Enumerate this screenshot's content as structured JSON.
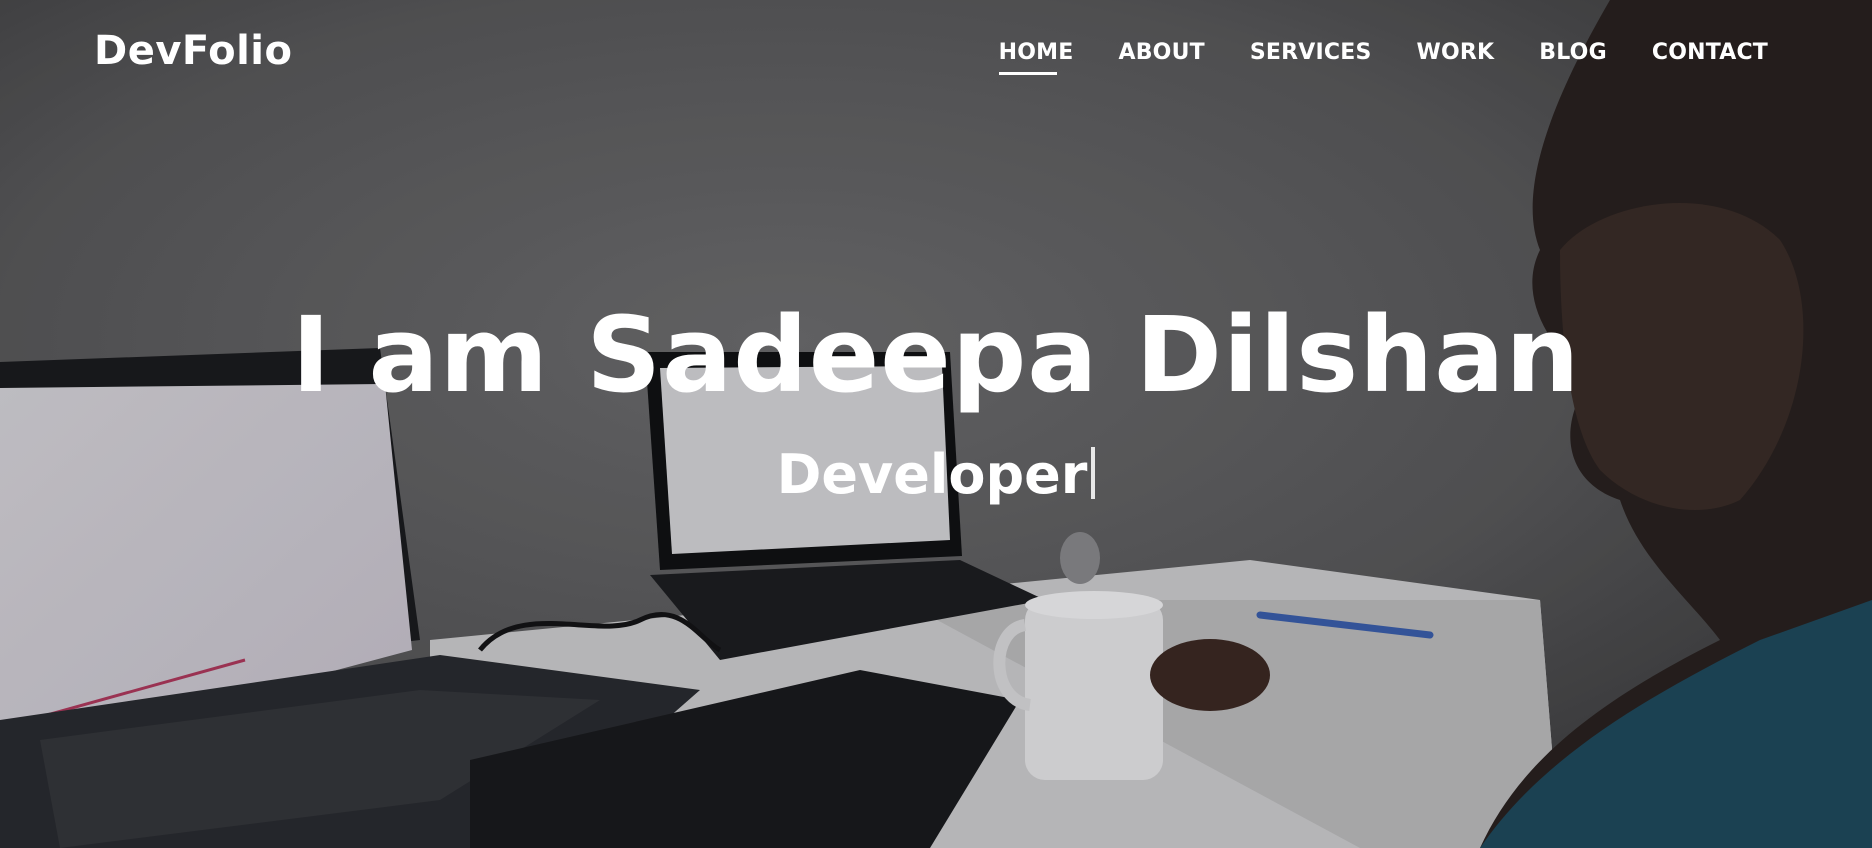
{
  "navbar": {
    "brand": "DevFolio",
    "items": [
      {
        "label": "HOME",
        "active": true
      },
      {
        "label": "ABOUT",
        "active": false
      },
      {
        "label": "SERVICES",
        "active": false
      },
      {
        "label": "WORK",
        "active": false
      },
      {
        "label": "BLOG",
        "active": false
      },
      {
        "label": "CONTACT",
        "active": false
      }
    ]
  },
  "hero": {
    "title": "I am Sadeepa Dilshan",
    "subtitle": "Developer",
    "background": "workspace photo with laptops, coffee mug and person at desk"
  },
  "colors": {
    "text": "#ffffff",
    "overlay": "#000000",
    "wall": "#5e5e60",
    "desk": "#e4e4e6",
    "shirt": "#1f4a5e"
  }
}
